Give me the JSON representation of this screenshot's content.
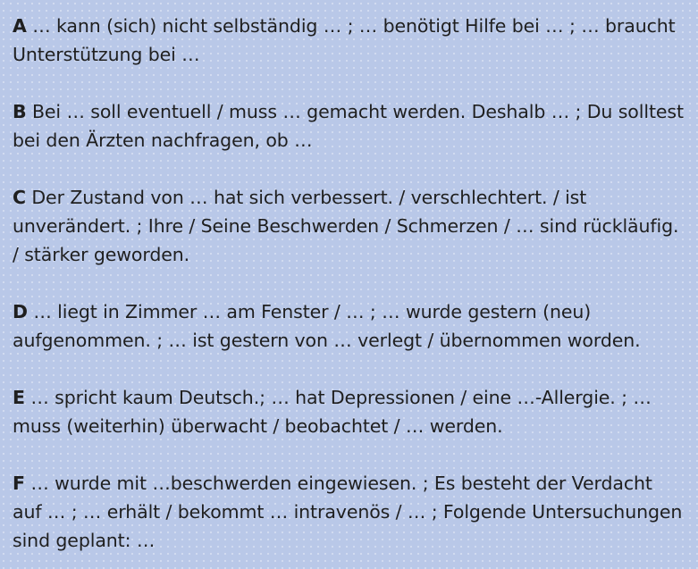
{
  "entries": [
    {
      "letter": "A",
      "text": "… kann (sich) nicht selbständig … ; … benötigt Hilfe bei … ; … braucht Unterstützung bei …"
    },
    {
      "letter": "B",
      "text": "Bei … soll eventuell / muss … gemacht werden. Deshalb … ; Du solltest bei den Ärzten nachfragen, ob …"
    },
    {
      "letter": "C",
      "text": "Der Zustand von … hat sich verbessert. / verschlechtert. / ist unverändert. ; Ihre / Seine Beschwerden / Schmerzen / … sind rückläufig. / stärker geworden."
    },
    {
      "letter": "D",
      "text": "… liegt in Zimmer … am Fenster / … ; … wurde gestern (neu) aufgenommen. ; … ist gestern von … verlegt / übernommen worden."
    },
    {
      "letter": "E",
      "text": "… spricht kaum Deutsch.; … hat Depressionen / eine …-Allergie. ; … muss (weiterhin) überwacht / beobachtet / … werden."
    },
    {
      "letter": "F",
      "text": "… wurde mit …beschwerden eingewiesen. ; Es besteht der Verdacht auf … ; … erhält / bekommt … intravenös / … ; Folgende Untersuchungen sind geplant: …"
    }
  ]
}
